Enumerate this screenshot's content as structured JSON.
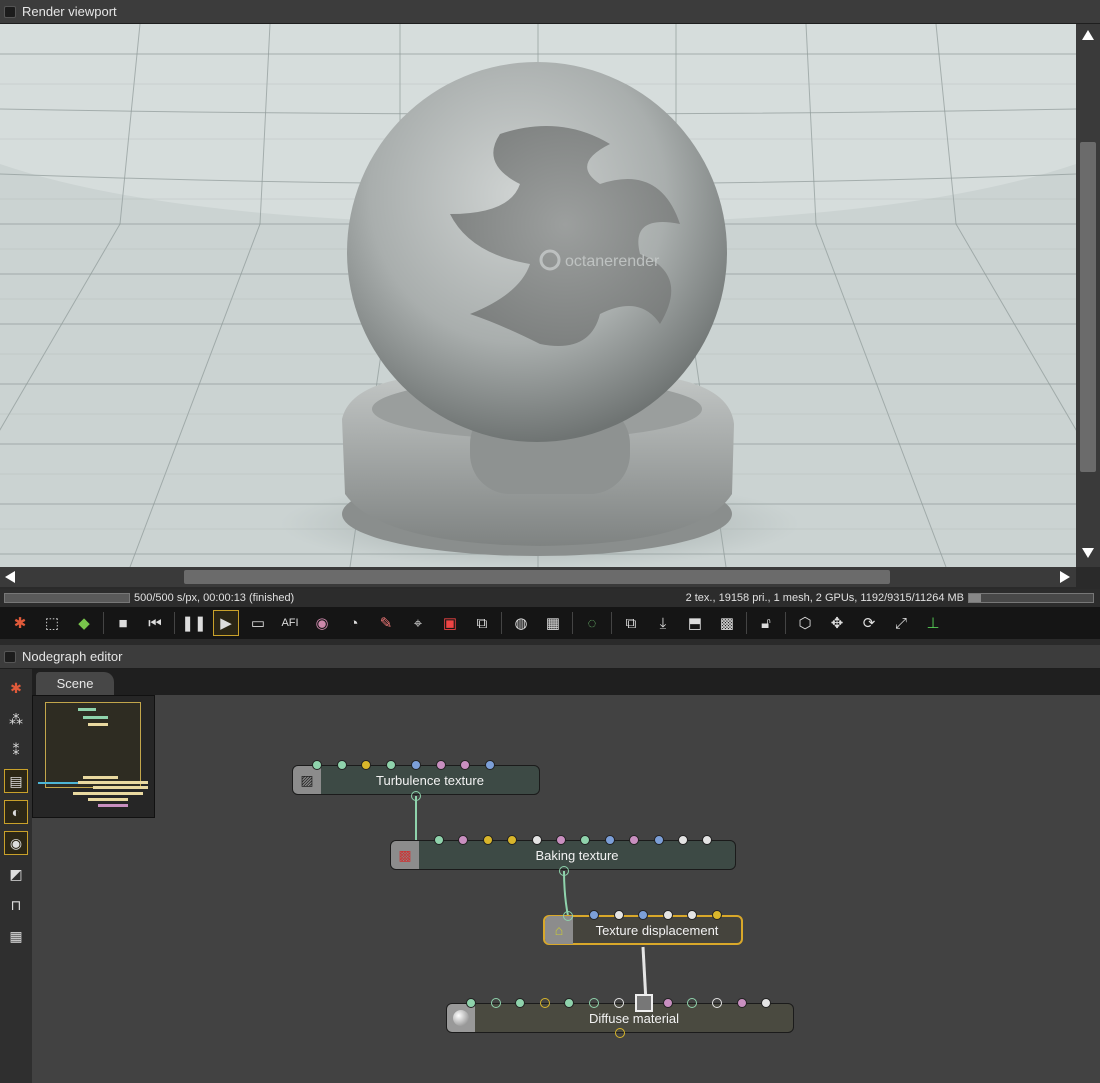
{
  "viewport": {
    "title": "Render viewport",
    "watermark": "octanerender",
    "status_left": "500/500 s/px, 00:00:13 (finished)",
    "status_right": "2 tex., 19158 pri., 1 mesh, 2 GPUs, 1192/9315/11264 MB",
    "render_progress": 1.0,
    "memory_usage_fraction": 0.1
  },
  "toolbar": {
    "icons": [
      "octane-logo-icon",
      "region-icon",
      "cube-color-icon",
      "stop-icon",
      "restart-icon",
      "pause-icon",
      "play-icon",
      "monitor-icon",
      "afi-text-icon",
      "color-wheel-icon",
      "material-picker-icon",
      "light-picker-icon",
      "focus-picker-icon",
      "camera-picker-icon",
      "region-picker-icon",
      "render-region-icon",
      "filmsize-icon",
      "clay-mode-icon",
      "subsample-icon",
      "copy-icon",
      "save-icon",
      "export-icon",
      "checker-icon",
      "lock-icon",
      "cube-wire-icon",
      "move-icon",
      "rotate-icon",
      "zoom-fit-icon",
      "axis-icon"
    ],
    "afi_label": "AFI"
  },
  "nodegraph": {
    "title": "Nodegraph editor",
    "tab": "Scene",
    "nodes": [
      {
        "id": "turbulence",
        "label": "Turbulence texture"
      },
      {
        "id": "baking",
        "label": "Baking texture"
      },
      {
        "id": "displacement",
        "label": "Texture displacement"
      },
      {
        "id": "diffuse",
        "label": "Diffuse material"
      }
    ]
  },
  "colors": {
    "accent": "#d9a82a",
    "pin_green": "#8fd3ac",
    "pin_yellow": "#d9b62b",
    "pin_blue": "#7c9fd8",
    "pin_pink": "#c98fc0",
    "pin_white": "#e4e4e4"
  }
}
